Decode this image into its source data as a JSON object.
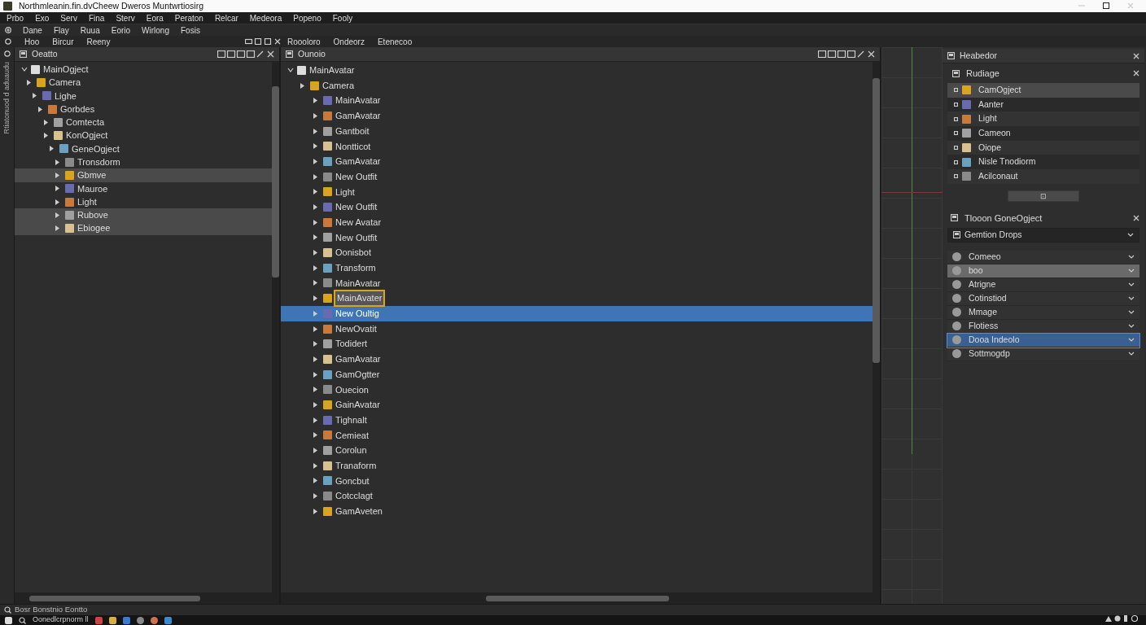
{
  "window": {
    "title": "Northmleanin.fin.dvCheew Dweros Muntwrtiosirg"
  },
  "menu_bar": [
    "Prbo",
    "Exo",
    "Serv",
    "Fina",
    "Sterv",
    "Eora",
    "Peraton",
    "Relcar",
    "Medeora",
    "Popeno",
    "Fooly"
  ],
  "toolbar": [
    "Dane",
    "Flay",
    "Ruua",
    "Eorio",
    "Wirlong",
    "Fosis"
  ],
  "left_tabs": [
    "Hoo",
    "Bircur",
    "Reeny"
  ],
  "center_tabs": [
    "Roooloro",
    "Ondeorz",
    "Etenecoo"
  ],
  "side_strip": {
    "label": "Rtiatonuod d aduaudu"
  },
  "hierarchy": {
    "title": "Oeatto",
    "items": [
      {
        "label": "MainOgject",
        "expanded": true,
        "selected": false,
        "children": [
          {
            "label": "Camera",
            "expanded": false,
            "selected": false,
            "children": [
              {
                "label": "Lighe",
                "expanded": false,
                "selected": false,
                "children": [
                  {
                    "label": "Gorbdes",
                    "expanded": false,
                    "selected": false,
                    "children": [
                      {
                        "label": "Comtecta",
                        "expanded": false,
                        "selected": false
                      },
                      {
                        "label": "KonOgject",
                        "expanded": false,
                        "selected": false,
                        "children": [
                          {
                            "label": "GeneOgject",
                            "expanded": false,
                            "selected": false,
                            "children": [
                              {
                                "label": "Tronsdorm",
                                "expanded": false,
                                "selected": false
                              },
                              {
                                "label": "Gbmve",
                                "expanded": false,
                                "selected": true
                              },
                              {
                                "label": "Mauroe",
                                "expanded": false,
                                "selected": false
                              },
                              {
                                "label": "Light",
                                "expanded": false,
                                "selected": false
                              },
                              {
                                "label": "Rubove",
                                "expanded": false,
                                "selected": true
                              },
                              {
                                "label": "Ebiogee",
                                "expanded": false,
                                "selected": true
                              }
                            ]
                          }
                        ]
                      }
                    ]
                  }
                ]
              }
            ]
          }
        ]
      }
    ]
  },
  "outline": {
    "title": "Ounoio",
    "items": [
      {
        "label": "MainAvatar",
        "expanded": true,
        "selected": false,
        "children": [
          {
            "label": "Camera",
            "expanded": false,
            "selected": false,
            "children": [
              {
                "label": "MainAvatar",
                "expanded": false,
                "selected": false
              },
              {
                "label": "GamAvatar",
                "expanded": false,
                "selected": false
              },
              {
                "label": "Gantboit",
                "expanded": false,
                "selected": false
              },
              {
                "label": "Nontticot",
                "expanded": false,
                "selected": false
              },
              {
                "label": "GamAvatar",
                "expanded": false,
                "selected": false
              },
              {
                "label": "New Outfit",
                "expanded": false,
                "selected": false
              },
              {
                "label": "Light",
                "expanded": false,
                "selected": false
              },
              {
                "label": "New Outfit",
                "expanded": false,
                "selected": false
              },
              {
                "label": "New Avatar",
                "expanded": false,
                "selected": false
              },
              {
                "label": "New Outfit",
                "expanded": false,
                "selected": false
              },
              {
                "label": "Oonisbot",
                "expanded": false,
                "selected": false
              },
              {
                "label": "Transform",
                "expanded": false,
                "selected": false
              },
              {
                "label": "MainAvatar",
                "expanded": false,
                "selected": false
              },
              {
                "label": "MainAvater",
                "expanded": false,
                "selected": false,
                "renaming": true
              },
              {
                "label": "New Oultig",
                "expanded": false,
                "selected": true
              },
              {
                "label": "NewOvatit",
                "expanded": false,
                "selected": false
              },
              {
                "label": "Todidert",
                "expanded": false,
                "selected": false
              },
              {
                "label": "GamAvatar",
                "expanded": false,
                "selected": false
              },
              {
                "label": "GamOgtter",
                "expanded": false,
                "selected": false
              },
              {
                "label": "Ouecion",
                "expanded": false,
                "selected": false
              },
              {
                "label": "GainAvatar",
                "expanded": false,
                "selected": false
              },
              {
                "label": "Tighnalt",
                "expanded": false,
                "selected": false
              },
              {
                "label": "Cemieat",
                "expanded": false,
                "selected": false
              },
              {
                "label": "Corolun",
                "expanded": false,
                "selected": false
              },
              {
                "label": "Tranaform",
                "expanded": false,
                "selected": false
              },
              {
                "label": "Goncbut",
                "expanded": false,
                "selected": false
              },
              {
                "label": "Cotcclagt",
                "expanded": false,
                "selected": false
              },
              {
                "label": "GamAveten",
                "expanded": false,
                "selected": false
              }
            ]
          }
        ]
      }
    ]
  },
  "inspector": {
    "title": "Heabedor",
    "list_title": "Rudiage",
    "items": [
      {
        "label": "CamOgject",
        "selected": true
      },
      {
        "label": "Aanter",
        "selected": false
      },
      {
        "label": "Light",
        "selected": false
      },
      {
        "label": "Cameon",
        "selected": false
      },
      {
        "label": "Oiope",
        "selected": false
      },
      {
        "label": "Nisle Tnodiorm",
        "selected": false
      },
      {
        "label": "Acilconaut",
        "selected": false
      }
    ],
    "button": "⊡",
    "component_title": "Tlooon GoneOgject",
    "dropdown": "Gemtion Drops",
    "components": [
      {
        "label": "Comeeo",
        "selected": false
      },
      {
        "label": "boo",
        "selected": true
      },
      {
        "label": "Atrigne",
        "selected": false
      },
      {
        "label": "Cotinstiod",
        "selected": false
      },
      {
        "label": "Mmage",
        "selected": false
      },
      {
        "label": "Flotiess",
        "selected": false
      },
      {
        "label": "Dooa Indeolo",
        "selected": true
      },
      {
        "label": "Sottmogdp",
        "selected": false
      }
    ]
  },
  "status_bar": "Bosr Bonstnio Eontto",
  "taskbar": {
    "app": "Oonedlcrpnorm ll"
  }
}
